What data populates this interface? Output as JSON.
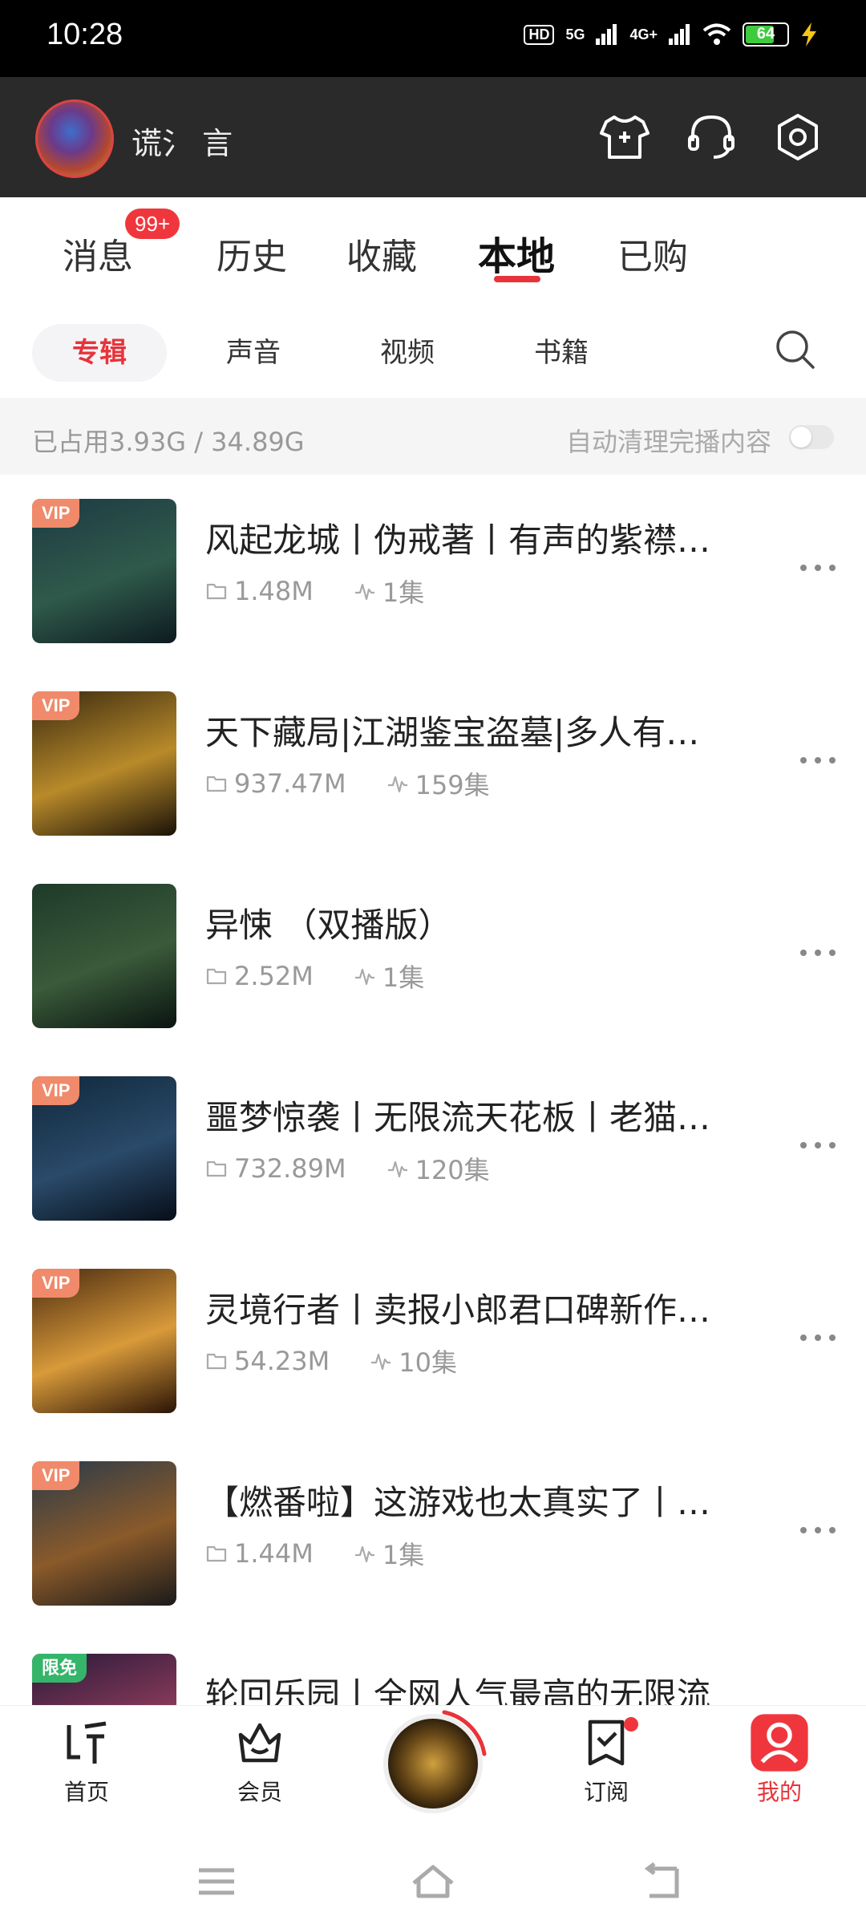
{
  "status_bar": {
    "time": "10:28",
    "hd_label": "HD",
    "net_5g": "5G",
    "net_4g": "4G+",
    "battery": "64"
  },
  "header": {
    "username": "谎氵 言"
  },
  "tabs": [
    {
      "label": "消息"
    },
    {
      "label": "历史"
    },
    {
      "label": "收藏"
    },
    {
      "label": "本地"
    },
    {
      "label": "已购"
    }
  ],
  "message_badge": "99+",
  "subtabs": [
    {
      "label": "专辑"
    },
    {
      "label": "声音"
    },
    {
      "label": "视频"
    },
    {
      "label": "书籍"
    }
  ],
  "storage": {
    "used": "已占用3.93G / 34.89G",
    "auto_clean": "自动清理完播内容"
  },
  "items": [
    {
      "tag": "VIP",
      "title": "风起龙城丨伪戒著丨有声的紫襟…",
      "size": "1.48M",
      "episodes": "1集",
      "cover_colors": [
        "#1d3a44",
        "#2f5a4a",
        "#0d1a20"
      ]
    },
    {
      "tag": "VIP",
      "title": "天下藏局|江湖鉴宝盗墓|多人有…",
      "size": "937.47M",
      "episodes": "159集",
      "cover_colors": [
        "#3a2a10",
        "#b88a2a",
        "#1a1208"
      ]
    },
    {
      "tag": "",
      "title": "异悚 （双播版）",
      "size": "2.52M",
      "episodes": "1集",
      "cover_colors": [
        "#1e3a2a",
        "#3a5a3a",
        "#0a1410"
      ]
    },
    {
      "tag": "VIP",
      "title": "噩梦惊袭丨无限流天花板丨老猫…",
      "size": "732.89M",
      "episodes": "120集",
      "cover_colors": [
        "#10283a",
        "#2a4a6a",
        "#060e18"
      ]
    },
    {
      "tag": "VIP",
      "title": "灵境行者丨卖报小郎君口碑新作…",
      "size": "54.23M",
      "episodes": "10集",
      "cover_colors": [
        "#4a2a10",
        "#d89a3a",
        "#2a1406"
      ]
    },
    {
      "tag": "VIP",
      "title": "【燃番啦】这游戏也太真实了丨…",
      "size": "1.44M",
      "episodes": "1集",
      "cover_colors": [
        "#2a3a4a",
        "#8a5a2a",
        "#1a1a1a"
      ]
    },
    {
      "tag": "限免",
      "title": "轮回乐园丨全网人气最高的无限流",
      "size": "",
      "episodes": "",
      "cover_colors": [
        "#2a1a3a",
        "#8a3a5a",
        "#141018"
      ]
    }
  ],
  "bottom_nav": [
    {
      "label": "首页"
    },
    {
      "label": "会员"
    },
    {
      "label": "订阅"
    },
    {
      "label": "我的"
    }
  ],
  "colors": {
    "accent": "#e8333a",
    "header_bg": "#2a2a2a",
    "vip_tag": "#f08a6a",
    "free_tag": "#35b56a"
  }
}
